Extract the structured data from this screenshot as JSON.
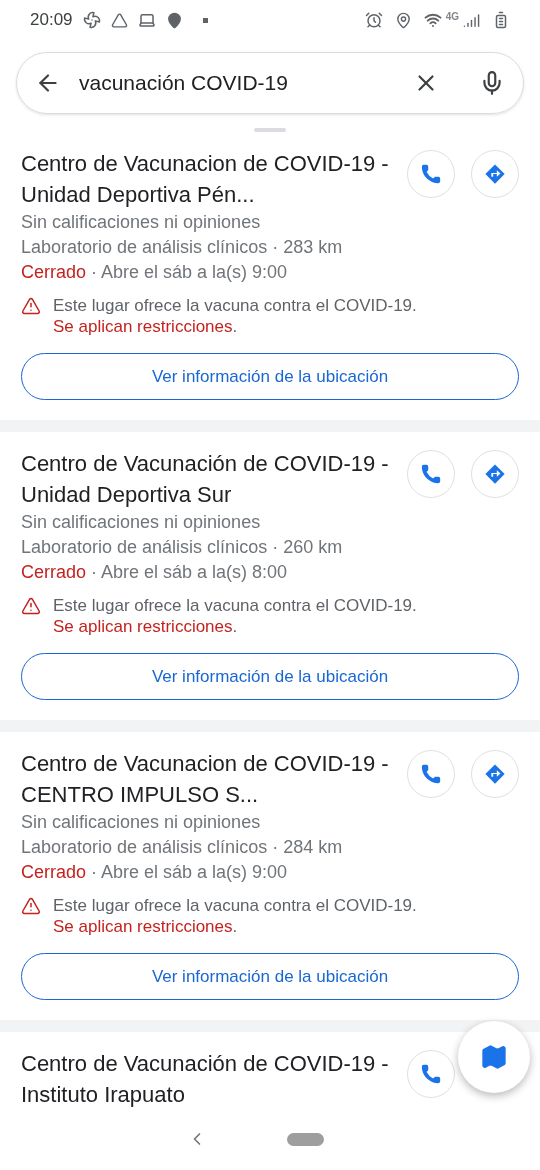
{
  "status_bar": {
    "time": "20:09",
    "network": "4G"
  },
  "search": {
    "value": "vacunación COVID-19"
  },
  "results": [
    {
      "title": "Centro de Vacunacion de COVID-19 - Unidad Deportiva Pén...",
      "rating": "Sin calificaciones ni opiniones",
      "category": "Laboratorio de análisis clínicos · 283 km",
      "status": "Cerrado",
      "hours": "· Abre el sáb a la(s) 9:00",
      "warning": {
        "text": "Este lugar ofrece la vacuna contra el COVID-19.",
        "link": "Se aplican restricciones",
        "end": "."
      },
      "action": "Ver información de la ubicación",
      "directions": true
    },
    {
      "title": "Centro de Vacunación de COVID-19 - Unidad Deportiva Sur",
      "rating": "Sin calificaciones ni opiniones",
      "category": "Laboratorio de análisis clínicos · 260 km",
      "status": "Cerrado",
      "hours": "· Abre el sáb a la(s) 8:00",
      "warning": {
        "text": "Este lugar ofrece la vacuna contra el COVID-19.",
        "link": "Se aplican restricciones",
        "end": "."
      },
      "action": "Ver información de la ubicación",
      "directions": true
    },
    {
      "title": "Centro de Vacunacion de COVID-19 - CENTRO IMPULSO S...",
      "rating": "Sin calificaciones ni opiniones",
      "category": "Laboratorio de análisis clínicos · 284 km",
      "status": "Cerrado",
      "hours": "· Abre el sáb a la(s) 9:00",
      "warning": {
        "text": "Este lugar ofrece la vacuna contra el COVID-19.",
        "link": "Se aplican restricciones",
        "end": "."
      },
      "action": "Ver información de la ubicación",
      "directions": true
    },
    {
      "title": "Centro de Vacunación de COVID-19 - Instituto Irapuato",
      "directions": false
    }
  ]
}
